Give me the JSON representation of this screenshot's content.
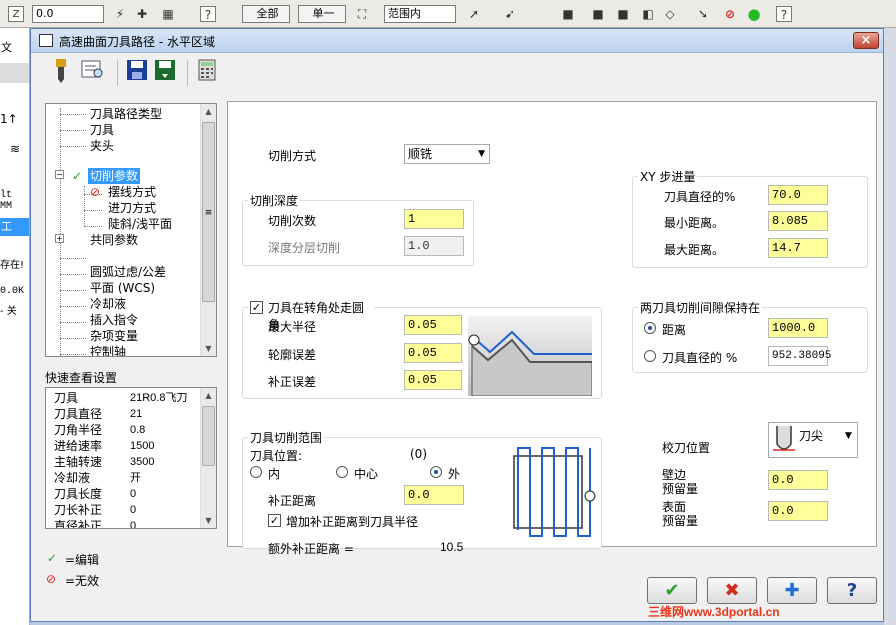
{
  "bg": {
    "toolbar": {
      "dropdown_z_label": "Z",
      "dropdown_value": "0.0",
      "btn_all": "全部",
      "btn_single": "单一",
      "range_select": "范围内"
    },
    "left_fragments": [
      "文",
      "工",
      "lt MM",
      "存在!",
      "0.0K",
      "- 关"
    ]
  },
  "dialog": {
    "title": "高速曲面刀具路径 - 水平区域",
    "close_label": "×"
  },
  "tree": {
    "items": [
      {
        "label": "刀具路径类型"
      },
      {
        "label": "刀具"
      },
      {
        "label": "夹头"
      },
      {
        "label": "切削参数"
      },
      {
        "label": "摆线方式"
      },
      {
        "label": "进刀方式"
      },
      {
        "label": "陡斜/浅平面"
      },
      {
        "label": "共同参数"
      },
      {
        "label": ""
      },
      {
        "label": "圆弧过虑/公差"
      },
      {
        "label": "平面 (WCS)"
      },
      {
        "label": "冷却液"
      },
      {
        "label": "插入指令"
      },
      {
        "label": "杂项变量"
      },
      {
        "label": "控制轴"
      }
    ],
    "expand_minus": "−",
    "expand_plus": "+",
    "scroll_mark": "≡"
  },
  "quickview": {
    "label": "快速查看设置",
    "rows": [
      {
        "k": "刀具",
        "v": "21R0.8飞刀"
      },
      {
        "k": "刀具直径",
        "v": "21"
      },
      {
        "k": "刀角半径",
        "v": "0.8"
      },
      {
        "k": "进给速率",
        "v": "1500"
      },
      {
        "k": "主轴转速",
        "v": "3500"
      },
      {
        "k": "冷却液",
        "v": "开"
      },
      {
        "k": "刀具长度",
        "v": "0"
      },
      {
        "k": "刀长补正",
        "v": "0"
      },
      {
        "k": "直径补正",
        "v": "0"
      }
    ]
  },
  "legend": {
    "edit": "=编辑",
    "invalid": "=无效"
  },
  "form": {
    "cut_method_label": "切削方式",
    "cut_method_value": "顺铣",
    "depth_group": "切削深度",
    "cut_count_label": "切削次数",
    "cut_count_value": "1",
    "layer_depth_label": "深度分层切削",
    "layer_depth_value": "1.0",
    "xy_group": "XY 步进量",
    "xy_dia_pct_label": "刀具直径的%",
    "xy_dia_pct_value": "70.0",
    "xy_min_label": "最小距离。",
    "xy_min_value": "8.085",
    "xy_max_label": "最大距离。",
    "xy_max_value": "14.7",
    "corner_check_label": "刀具在转角处走圆角",
    "max_radius_label": "最大半径",
    "max_radius_value": "0.05",
    "contour_err_label": "轮廓误差",
    "contour_err_value": "0.05",
    "comp_err_label": "补正误差",
    "comp_err_value": "0.05",
    "gap_group": "两刀具切削间隙保持在",
    "gap_dist_label": "距离",
    "gap_dist_value": "1000.0",
    "gap_pct_label": "刀具直径的 %",
    "gap_pct_value": "952.38095",
    "range_group": "刀具切削范围",
    "tool_pos_label": "刀具位置:",
    "tool_pos_code": "(0)",
    "pos_inner": "内",
    "pos_center": "中心",
    "pos_outer": "外",
    "comp_dist_label": "补正距离",
    "comp_dist_value": "0.0",
    "add_comp_label": "增加补正距离到刀具半径",
    "extra_comp_label": "额外补正距离 =",
    "extra_comp_value": "10.5",
    "tool_pos_select_label": "校刀位置",
    "tool_pos_select_value": "刀尖",
    "wall_stock_label": "壁边\n预留量",
    "wall_stock_l1": "壁边",
    "wall_stock_l2": "预留量",
    "wall_stock_value": "0.0",
    "floor_stock_l1": "表面",
    "floor_stock_l2": "预留量",
    "floor_stock_value": "0.0"
  },
  "buttons": {
    "ok": "✔",
    "cancel": "✖",
    "add": "✚",
    "help": "?"
  },
  "watermark": "三维网www.3dportal.cn",
  "colors": {
    "selection": "#3399ff",
    "input_bg": "#ffff99",
    "preview_path": "#1f5fd0",
    "ok_green": "#2e9e2e",
    "cancel_red": "#d6281a",
    "add_blue": "#1f6fd8"
  }
}
